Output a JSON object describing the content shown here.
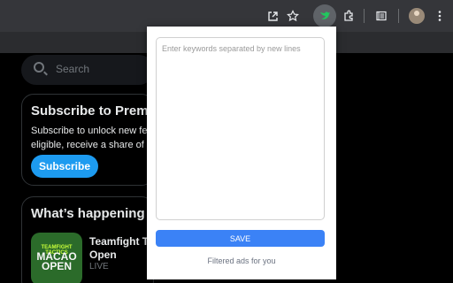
{
  "browser": {
    "icons": {
      "share": "open-in-new-icon",
      "bookmark": "star-icon",
      "extension_active": "bird-icon",
      "extensions": "puzzle-icon",
      "reading_list": "sidebar-icon",
      "profile": "avatar",
      "menu": "kebab-menu-icon"
    },
    "accent_active": "#22c55e"
  },
  "page": {
    "search_placeholder": "Search",
    "premium_card": {
      "title": "Subscribe to Prem",
      "body_line1": "Subscribe to unlock new fe",
      "body_line2": "eligible, receive a share of",
      "button_label": "Subscribe"
    },
    "happening_card": {
      "title": "What’s happening",
      "trend": {
        "thumb_line1": "TEAMFIGHT TACTICS",
        "thumb_line2a": "MACAO",
        "thumb_line2b": "OPEN",
        "title_line1": "Teamfight Ta",
        "title_line2": "Open",
        "status": "LIVE"
      }
    }
  },
  "popup": {
    "keywords_placeholder": "Enter keywords separated by new lines",
    "keywords_value": "",
    "save_label": "SAVE",
    "footer_text": "Filtered ads for you",
    "save_color": "#3b82f6"
  }
}
